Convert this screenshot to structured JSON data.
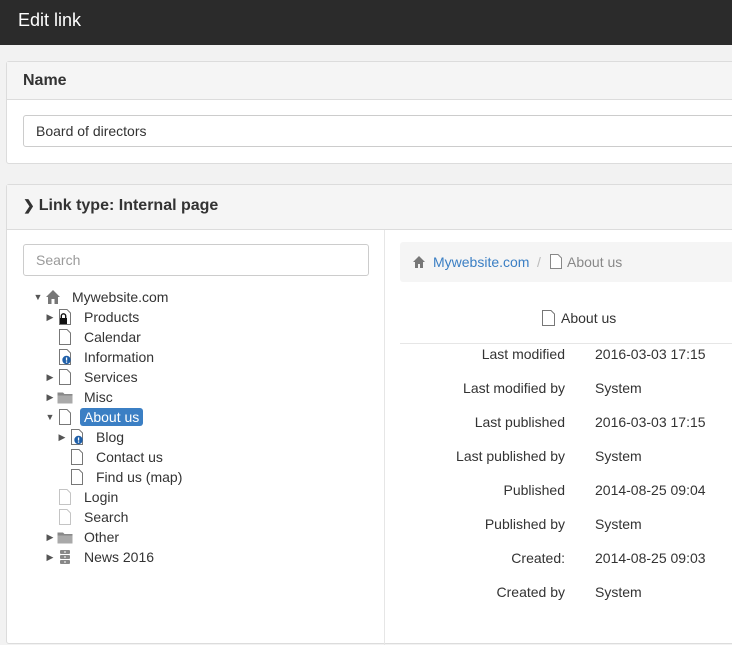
{
  "header": {
    "title": "Edit link"
  },
  "name_panel": {
    "label": "Name",
    "value": "Board of directors"
  },
  "link_panel": {
    "label": "Link type: Internal page",
    "search_placeholder": "Search"
  },
  "tree": [
    {
      "id": "mywebsite",
      "label": "Mywebsite.com",
      "icon": "home-icon",
      "arrow": "expanded",
      "level": 0
    },
    {
      "id": "products",
      "label": "Products",
      "icon": "lock-icon",
      "arrow": "collapsed",
      "level": 1
    },
    {
      "id": "calendar",
      "label": "Calendar",
      "icon": "page-icon",
      "arrow": "none",
      "level": 1
    },
    {
      "id": "information",
      "label": "Information",
      "icon": "page-info-icon",
      "arrow": "none",
      "level": 1
    },
    {
      "id": "services",
      "label": "Services",
      "icon": "page-icon",
      "arrow": "collapsed",
      "level": 1
    },
    {
      "id": "misc",
      "label": "Misc",
      "icon": "folder-icon",
      "arrow": "collapsed",
      "level": 1
    },
    {
      "id": "about",
      "label": "About us",
      "icon": "page-icon",
      "arrow": "expanded",
      "level": 1,
      "selected": true
    },
    {
      "id": "blog",
      "label": "Blog",
      "icon": "page-info-icon",
      "arrow": "collapsed",
      "level": 2
    },
    {
      "id": "contact",
      "label": "Contact us",
      "icon": "page-icon",
      "arrow": "none",
      "level": 2
    },
    {
      "id": "findus",
      "label": "Find us (map)",
      "icon": "page-icon",
      "arrow": "none",
      "level": 2
    },
    {
      "id": "login",
      "label": "Login",
      "icon": "page-faded-icon",
      "arrow": "none",
      "level": 1
    },
    {
      "id": "search",
      "label": "Search",
      "icon": "page-faded-icon",
      "arrow": "none",
      "level": 1
    },
    {
      "id": "other",
      "label": "Other",
      "icon": "folder-icon",
      "arrow": "collapsed",
      "level": 1
    },
    {
      "id": "news",
      "label": "News 2016",
      "icon": "archive-icon",
      "arrow": "collapsed",
      "level": 1
    }
  ],
  "breadcrumb": {
    "root": "Mywebsite.com",
    "separator": "/",
    "current": "About us"
  },
  "selected_page": {
    "title": "About us"
  },
  "meta": [
    {
      "key": "Last modified",
      "value": "2016-03-03 17:15"
    },
    {
      "key": "Last modified by",
      "value": "System"
    },
    {
      "key": "Last published",
      "value": "2016-03-03 17:15"
    },
    {
      "key": "Last published by",
      "value": "System"
    },
    {
      "key": "Published",
      "value": "2014-08-25 09:04"
    },
    {
      "key": "Published by",
      "value": "System"
    },
    {
      "key": "Created:",
      "value": "2014-08-25 09:03"
    },
    {
      "key": "Created by",
      "value": "System"
    }
  ],
  "colors": {
    "topbar": "#2b2b2b",
    "accent": "#3b7fc4",
    "info_badge": "#1f5fa8"
  }
}
